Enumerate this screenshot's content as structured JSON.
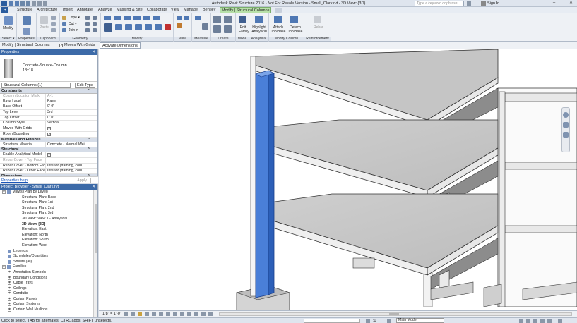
{
  "app_title": "Autodesk Revit Structure 2016 - Not For Resale Version -     Small_Clark.rvt - 3D View: {3D}",
  "search_placeholder": "Type a keyword or phrase",
  "sign_in": "Sign In",
  "tabs": [
    "Structure",
    "Architecture",
    "Insert",
    "Annotate",
    "Analyze",
    "Massing & Site",
    "Collaborate",
    "View",
    "Manage",
    "Bentley",
    "Modify | Structural Columns"
  ],
  "ribbon": {
    "select_label": "Select ▾",
    "properties_label": "Properties",
    "clipboard_label": "Clipboard",
    "geometry_label": "Geometry",
    "modify_label": "Modify",
    "view_label": "View",
    "measure_label": "Measure",
    "create_label": "Create",
    "mode_label": "Mode",
    "analytical_label": "Analytical",
    "modify_column_label": "Modify Column",
    "reinforcement_label": "Reinforcement",
    "modify_btn": "Modify",
    "cope": "Cope ▾",
    "cut": "Cut ▾",
    "join": "Join ▾",
    "paste": "Paste",
    "edit_family": "Edit Family",
    "highlight_analytical": "Highlight Analytical",
    "attach": "Attach Top/Base",
    "detach": "Detach Top/Base",
    "rebar": "Rebar"
  },
  "options_bar": {
    "context": "Modify | Structural Columns",
    "moves_with_grids": "Moves With Grids",
    "activate_dimensions": "Activate Dimensions"
  },
  "properties": {
    "header": "Properties",
    "type_name": "Concrete-Square-Column",
    "type_size": "18x18",
    "filter": "Structural Columns (1)",
    "edit_type": "Edit Type",
    "categories": [
      {
        "name": "Constraints",
        "rows": [
          {
            "k": "Column Location Mark",
            "v": "A-1",
            "dim": true
          },
          {
            "k": "Base Level",
            "v": "Base"
          },
          {
            "k": "Base Offset",
            "v": "0' 0\""
          },
          {
            "k": "Top Level",
            "v": "3rd"
          },
          {
            "k": "Top Offset",
            "v": "0' 0\""
          },
          {
            "k": "Column Style",
            "v": "Vertical"
          },
          {
            "k": "Moves With Grids",
            "v": "☑",
            "chk": true
          },
          {
            "k": "Room Bounding",
            "v": "☑",
            "chk": true
          }
        ]
      },
      {
        "name": "Materials and Finishes",
        "rows": [
          {
            "k": "Structural Material",
            "v": "Concrete - Normal Wei..."
          }
        ]
      },
      {
        "name": "Structural",
        "rows": [
          {
            "k": "Enable Analytical Model",
            "v": "☑",
            "chk": true
          },
          {
            "k": "Rebar Cover - Top Face",
            "v": "",
            "dim": true
          },
          {
            "k": "Rebar Cover - Bottom Face",
            "v": "Interior (framing, colu..."
          },
          {
            "k": "Rebar Cover - Other Faces",
            "v": "Interior (framing, colu..."
          }
        ]
      },
      {
        "name": "Dimensions",
        "rows": []
      }
    ],
    "help": "Properties help",
    "apply": "Apply"
  },
  "browser": {
    "header": "Project Browser - Small_Clark.rvt",
    "nodes": [
      {
        "t": "Views (Plan by Level)",
        "d": 0,
        "tg": "−",
        "ic": true
      },
      {
        "t": "Structural Plan: Base",
        "d": 2
      },
      {
        "t": "Structural Plan: 1st",
        "d": 2
      },
      {
        "t": "Structural Plan: 2nd",
        "d": 2
      },
      {
        "t": "Structural Plan: 3rd",
        "d": 2
      },
      {
        "t": "3D View: View 1 - Analytical",
        "d": 2
      },
      {
        "t": "3D View: {3D}",
        "d": 2,
        "b": true
      },
      {
        "t": "Elevation: East",
        "d": 2
      },
      {
        "t": "Elevation: North",
        "d": 2
      },
      {
        "t": "Elevation: South",
        "d": 2
      },
      {
        "t": "Elevation: West",
        "d": 2
      },
      {
        "t": "Legends",
        "d": 1,
        "ic": true
      },
      {
        "t": "Schedules/Quantities",
        "d": 1,
        "ic": true
      },
      {
        "t": "Sheets (all)",
        "d": 1,
        "ic": true
      },
      {
        "t": "Families",
        "d": 0,
        "tg": "−",
        "ic": true
      },
      {
        "t": "Annotation Symbols",
        "d": 1,
        "tg": "+"
      },
      {
        "t": "Boundary Conditions",
        "d": 1,
        "tg": "+"
      },
      {
        "t": "Cable Trays",
        "d": 1,
        "tg": "+"
      },
      {
        "t": "Ceilings",
        "d": 1,
        "tg": "+"
      },
      {
        "t": "Conduits",
        "d": 1,
        "tg": "+"
      },
      {
        "t": "Curtain Panels",
        "d": 1,
        "tg": "+"
      },
      {
        "t": "Curtain Systems",
        "d": 1,
        "tg": "+"
      },
      {
        "t": "Curtain Wall Mullions",
        "d": 1,
        "tg": "+"
      }
    ]
  },
  "view_status": {
    "scale": "1/8\" = 1'-0\""
  },
  "status": {
    "message": "Click to select, TAB for alternates, CTRL adds, SHIFT unselects.",
    "model": "Main Model",
    "zero": ":0"
  }
}
